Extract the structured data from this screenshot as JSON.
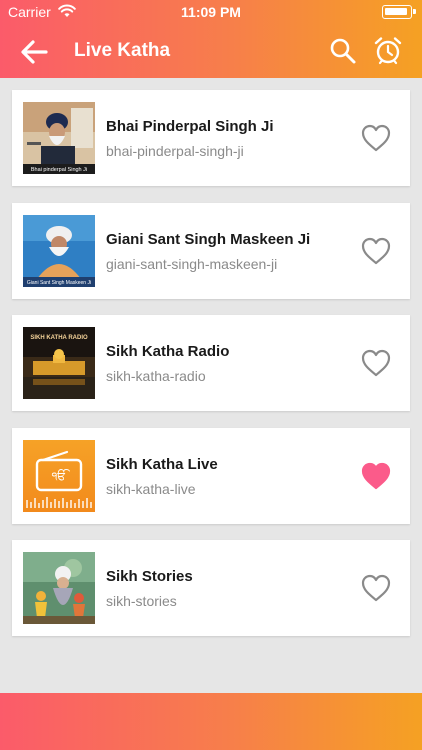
{
  "status_bar": {
    "carrier": "Carrier",
    "time": "11:09 PM"
  },
  "header": {
    "title": "Live Katha"
  },
  "icons": {
    "back": "arrow-left-icon",
    "search": "search-icon",
    "alarm": "alarm-clock-icon",
    "favorite": "heart-icon"
  },
  "colors": {
    "accent_start": "#fb5b6a",
    "accent_end": "#f5a123",
    "favorite_active": "#fb5b8a",
    "favorite_inactive": "#8a8a8a"
  },
  "items": [
    {
      "title": "Bhai Pinderpal Singh Ji",
      "subtitle": "bhai-pinderpal-singh-ji",
      "favorited": false,
      "thumb_caption": "Bhai pinderpal Singh Ji"
    },
    {
      "title": "Giani Sant Singh Maskeen Ji",
      "subtitle": "giani-sant-singh-maskeen-ji",
      "favorited": false,
      "thumb_caption": "Giani Sant Singh Maskeen Ji"
    },
    {
      "title": "Sikh Katha Radio",
      "subtitle": "sikh-katha-radio",
      "favorited": false,
      "thumb_caption": "SIKH KATHA RADIO"
    },
    {
      "title": "Sikh Katha Live",
      "subtitle": "sikh-katha-live",
      "favorited": true
    },
    {
      "title": "Sikh Stories",
      "subtitle": "sikh-stories",
      "favorited": false
    }
  ]
}
